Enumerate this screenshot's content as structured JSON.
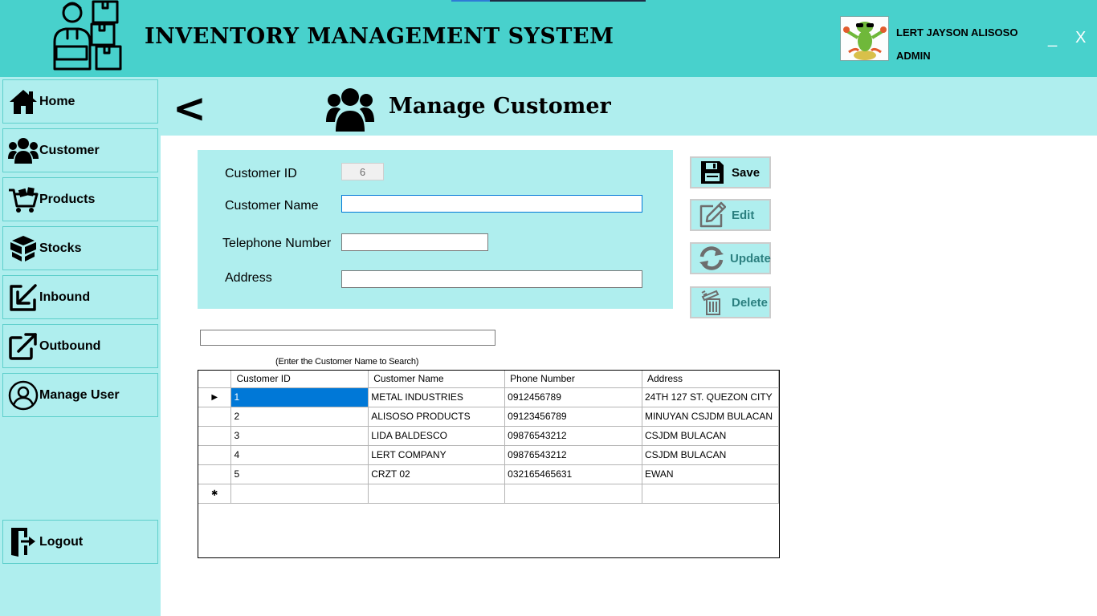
{
  "header": {
    "app_title": "INVENTORY MANAGEMENT SYSTEM",
    "user_name": "LERT JAYSON ALISOSO",
    "user_role": "ADMIN",
    "minimize_label": "_",
    "close_label": "X"
  },
  "sidebar": {
    "items": [
      {
        "label": "Home",
        "icon": "home-icon"
      },
      {
        "label": "Customer",
        "icon": "users-icon"
      },
      {
        "label": "Products",
        "icon": "cart-icon"
      },
      {
        "label": "Stocks",
        "icon": "boxes-icon"
      },
      {
        "label": "Inbound",
        "icon": "inbound-arrow-icon"
      },
      {
        "label": "Outbound",
        "icon": "outbound-arrow-icon"
      },
      {
        "label": "Manage User",
        "icon": "user-circle-icon"
      }
    ],
    "logout": {
      "label": "Logout",
      "icon": "logout-icon"
    }
  },
  "page": {
    "back_label": "<",
    "title": "Manage Customer"
  },
  "form": {
    "customer_id_label": "Customer ID",
    "customer_id_value": "6",
    "customer_name_label": "Customer Name",
    "customer_name_value": "",
    "telephone_label": "Telephone Number",
    "telephone_value": "",
    "address_label": "Address",
    "address_value": ""
  },
  "actions": {
    "save": {
      "label": "Save",
      "enabled": true
    },
    "edit": {
      "label": "Edit",
      "enabled": false
    },
    "update": {
      "label": "Update",
      "enabled": false
    },
    "delete": {
      "label": "Delete",
      "enabled": false
    }
  },
  "search": {
    "value": "",
    "hint": "(Enter the Customer Name to Search)"
  },
  "grid": {
    "columns": [
      "Customer ID",
      "Customer Name",
      "Phone Number",
      "Address"
    ],
    "rows": [
      [
        "1",
        "METAL INDUSTRIES",
        "0912456789",
        "24TH 127 ST. QUEZON CITY"
      ],
      [
        "2",
        "ALISOSO PRODUCTS",
        "09123456789",
        "MINUYAN CSJDM BULACAN"
      ],
      [
        "3",
        "LIDA BALDESCO",
        "09876543212",
        "CSJDM BULACAN"
      ],
      [
        "4",
        "LERT COMPANY",
        "09876543212",
        "CSJDM BULACAN"
      ],
      [
        "5",
        "CRZT 02",
        "032165465631",
        "EWAN"
      ]
    ],
    "current_row_marker": "▶",
    "new_row_marker": "✱"
  },
  "colors": {
    "header_bg": "#48d1cc",
    "panel_bg": "#afeeee",
    "selection": "#0078d7"
  }
}
